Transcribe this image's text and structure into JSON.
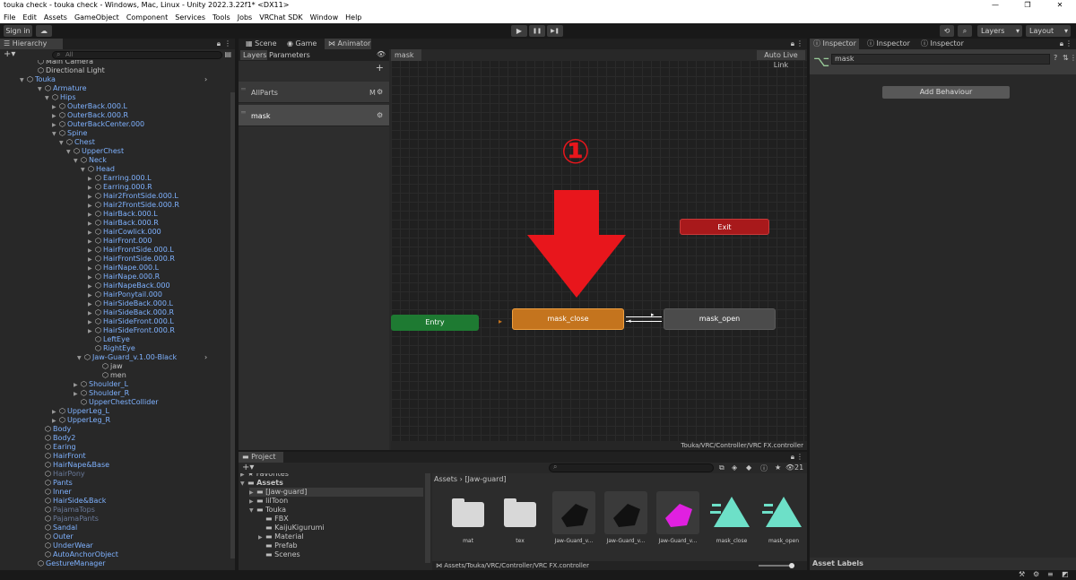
{
  "window": {
    "title": "touka check - touka check - Windows, Mac, Linux - Unity 2022.3.22f1* <DX11>",
    "controls": [
      "—",
      "❐",
      "✕"
    ]
  },
  "menu": [
    "File",
    "Edit",
    "Assets",
    "GameObject",
    "Component",
    "Services",
    "Tools",
    "Jobs",
    "VRChat SDK",
    "Window",
    "Help"
  ],
  "toolbar": {
    "signin": "Sign in",
    "cloud_icon": "cloud-icon",
    "play": "▶",
    "pause": "❚❚",
    "step": "▶❚",
    "history_icon": "history-icon",
    "search_icon": "search-icon",
    "layers": "Layers",
    "layout": "Layout"
  },
  "hierarchy": {
    "tab": "Hierarchy",
    "search_placeholder": "All",
    "rows": [
      {
        "label": "Main Camera",
        "indent": 0,
        "arrow": "",
        "style": "normal"
      },
      {
        "label": "Directional Light",
        "indent": 0,
        "arrow": "",
        "style": "normal"
      },
      {
        "label": "Touka",
        "indent": 0,
        "arrow": "▼",
        "style": "blue"
      },
      {
        "label": "Armature",
        "indent": 1,
        "arrow": "▼",
        "style": "blue"
      },
      {
        "label": "Hips",
        "indent": 2,
        "arrow": "▼",
        "style": "blue"
      },
      {
        "label": "OuterBack.000.L",
        "indent": 3,
        "arrow": "▶",
        "style": "blue"
      },
      {
        "label": "OuterBack.000.R",
        "indent": 3,
        "arrow": "▶",
        "style": "blue"
      },
      {
        "label": "OuterBackCenter.000",
        "indent": 3,
        "arrow": "▶",
        "style": "blue"
      },
      {
        "label": "Spine",
        "indent": 3,
        "arrow": "▼",
        "style": "blue"
      },
      {
        "label": "Chest",
        "indent": 4,
        "arrow": "▼",
        "style": "blue"
      },
      {
        "label": "UpperChest",
        "indent": 5,
        "arrow": "▼",
        "style": "blue"
      },
      {
        "label": "Neck",
        "indent": 6,
        "arrow": "▼",
        "style": "blue"
      },
      {
        "label": "Head",
        "indent": 7,
        "arrow": "▼",
        "style": "blue"
      },
      {
        "label": "Earring.000.L",
        "indent": 8,
        "arrow": "▶",
        "style": "blue"
      },
      {
        "label": "Earring.000.R",
        "indent": 8,
        "arrow": "▶",
        "style": "blue"
      },
      {
        "label": "Hair2FrontSide.000.L",
        "indent": 8,
        "arrow": "▶",
        "style": "blue"
      },
      {
        "label": "Hair2FrontSide.000.R",
        "indent": 8,
        "arrow": "▶",
        "style": "blue"
      },
      {
        "label": "HairBack.000.L",
        "indent": 8,
        "arrow": "▶",
        "style": "blue"
      },
      {
        "label": "HairBack.000.R",
        "indent": 8,
        "arrow": "▶",
        "style": "blue"
      },
      {
        "label": "HairCowlick.000",
        "indent": 8,
        "arrow": "▶",
        "style": "blue"
      },
      {
        "label": "HairFront.000",
        "indent": 8,
        "arrow": "▶",
        "style": "blue"
      },
      {
        "label": "HairFrontSide.000.L",
        "indent": 8,
        "arrow": "▶",
        "style": "blue"
      },
      {
        "label": "HairFrontSide.000.R",
        "indent": 8,
        "arrow": "▶",
        "style": "blue"
      },
      {
        "label": "HairNape.000.L",
        "indent": 8,
        "arrow": "▶",
        "style": "blue"
      },
      {
        "label": "HairNape.000.R",
        "indent": 8,
        "arrow": "▶",
        "style": "blue"
      },
      {
        "label": "HairNapeBack.000",
        "indent": 8,
        "arrow": "▶",
        "style": "blue"
      },
      {
        "label": "HairPonytail.000",
        "indent": 8,
        "arrow": "▶",
        "style": "blue"
      },
      {
        "label": "HairSideBack.000.L",
        "indent": 8,
        "arrow": "▶",
        "style": "blue"
      },
      {
        "label": "HairSideBack.000.R",
        "indent": 8,
        "arrow": "▶",
        "style": "blue"
      },
      {
        "label": "HairSideFront.000.L",
        "indent": 8,
        "arrow": "▶",
        "style": "blue"
      },
      {
        "label": "HairSideFront.000.R",
        "indent": 8,
        "arrow": "▶",
        "style": "blue"
      },
      {
        "label": "LeftEye",
        "indent": 8,
        "arrow": "",
        "style": "blue"
      },
      {
        "label": "RightEye",
        "indent": 8,
        "arrow": "",
        "style": "blue"
      },
      {
        "label": "Jaw-Guard_v.1.00-Black",
        "indent": 8,
        "arrow": "▼",
        "style": "blue"
      },
      {
        "label": "jaw",
        "indent": 9,
        "arrow": "",
        "style": "normal"
      },
      {
        "label": "men",
        "indent": 9,
        "arrow": "",
        "style": "normal"
      },
      {
        "label": "Shoulder_L",
        "indent": 6,
        "arrow": "▶",
        "style": "blue"
      },
      {
        "label": "Shoulder_R",
        "indent": 6,
        "arrow": "▶",
        "style": "blue"
      },
      {
        "label": "UpperChestCollider",
        "indent": 6,
        "arrow": "",
        "style": "blue"
      },
      {
        "label": "UpperLeg_L",
        "indent": 3,
        "arrow": "▶",
        "style": "blue"
      },
      {
        "label": "UpperLeg_R",
        "indent": 3,
        "arrow": "▶",
        "style": "blue"
      },
      {
        "label": "Body",
        "indent": 1,
        "arrow": "",
        "style": "blue"
      },
      {
        "label": "Body2",
        "indent": 1,
        "arrow": "",
        "style": "blue"
      },
      {
        "label": "Earing",
        "indent": 1,
        "arrow": "",
        "style": "blue"
      },
      {
        "label": "HairFront",
        "indent": 1,
        "arrow": "",
        "style": "blue"
      },
      {
        "label": "HairNape&Base",
        "indent": 1,
        "arrow": "",
        "style": "blue"
      },
      {
        "label": "HairPony",
        "indent": 1,
        "arrow": "",
        "style": "dim"
      },
      {
        "label": "Pants",
        "indent": 1,
        "arrow": "",
        "style": "blue"
      },
      {
        "label": "Inner",
        "indent": 1,
        "arrow": "",
        "style": "blue"
      },
      {
        "label": "HairSide&Back",
        "indent": 1,
        "arrow": "",
        "style": "blue"
      },
      {
        "label": "PajamaTops",
        "indent": 1,
        "arrow": "",
        "style": "dim"
      },
      {
        "label": "PajamaPants",
        "indent": 1,
        "arrow": "",
        "style": "dim"
      },
      {
        "label": "Sandal",
        "indent": 1,
        "arrow": "",
        "style": "blue"
      },
      {
        "label": "Outer",
        "indent": 1,
        "arrow": "",
        "style": "blue"
      },
      {
        "label": "UnderWear",
        "indent": 1,
        "arrow": "",
        "style": "blue"
      },
      {
        "label": "AutoAnchorObject",
        "indent": 1,
        "arrow": "",
        "style": "blue"
      },
      {
        "label": "GestureManager",
        "indent": 0,
        "arrow": "",
        "style": "blue"
      }
    ]
  },
  "center_tabs": [
    "Scene",
    "Game",
    "Animator"
  ],
  "animator": {
    "subtab_layers": "Layers",
    "subtab_parameters": "Parameters",
    "breadcrumb": "mask",
    "auto_live_link": "Auto Live Link",
    "layers": [
      {
        "name": "AllParts",
        "badge": "M"
      },
      {
        "name": "mask",
        "badge": ""
      }
    ],
    "states": {
      "entry": "Entry",
      "mask_close": "mask_close",
      "mask_open": "mask_open",
      "exit": "Exit"
    },
    "annotation": "①",
    "footer_path": "Touka/VRC/Controller/VRC FX.controller"
  },
  "project": {
    "tab": "Project",
    "tree": [
      {
        "label": "Favorites",
        "indent": 0,
        "arrow": "▶"
      },
      {
        "label": "Assets",
        "indent": 0,
        "arrow": "▼"
      },
      {
        "label": "[Jaw-guard]",
        "indent": 1,
        "arrow": "▶"
      },
      {
        "label": "lilToon",
        "indent": 1,
        "arrow": "▶"
      },
      {
        "label": "Touka",
        "indent": 1,
        "arrow": "▼"
      },
      {
        "label": "FBX",
        "indent": 2,
        "arrow": ""
      },
      {
        "label": "KaijuKigurumi",
        "indent": 2,
        "arrow": ""
      },
      {
        "label": "Material",
        "indent": 2,
        "arrow": "▶"
      },
      {
        "label": "Prefab",
        "indent": 2,
        "arrow": ""
      },
      {
        "label": "Scenes",
        "indent": 2,
        "arrow": ""
      }
    ],
    "breadcrumb": "Assets › [Jaw-guard]",
    "count": "21",
    "assets": [
      {
        "name": "mat",
        "kind": "folder"
      },
      {
        "name": "tex",
        "kind": "folder"
      },
      {
        "name": "Jaw-Guard_v...",
        "kind": "model-black"
      },
      {
        "name": "Jaw-Guard_v...",
        "kind": "model-black2"
      },
      {
        "name": "Jaw-Guard_v...",
        "kind": "model-pink"
      },
      {
        "name": "mask_close",
        "kind": "anim"
      },
      {
        "name": "mask_open",
        "kind": "anim"
      }
    ],
    "footer_path": "Assets/Touka/VRC/Controller/VRC FX.controller"
  },
  "inspector": {
    "tabs": [
      "Inspector",
      "Inspector",
      "Inspector"
    ],
    "name_field": "mask",
    "add_behaviour": "Add Behaviour",
    "asset_labels": "Asset Labels"
  },
  "colors": {
    "entry": "#1e7a32",
    "mask_close": "#c4741e",
    "mask_open": "#4b4b4b",
    "exit": "#a8191b",
    "arrow": "#e8161c",
    "selection": "#2c5d87"
  }
}
